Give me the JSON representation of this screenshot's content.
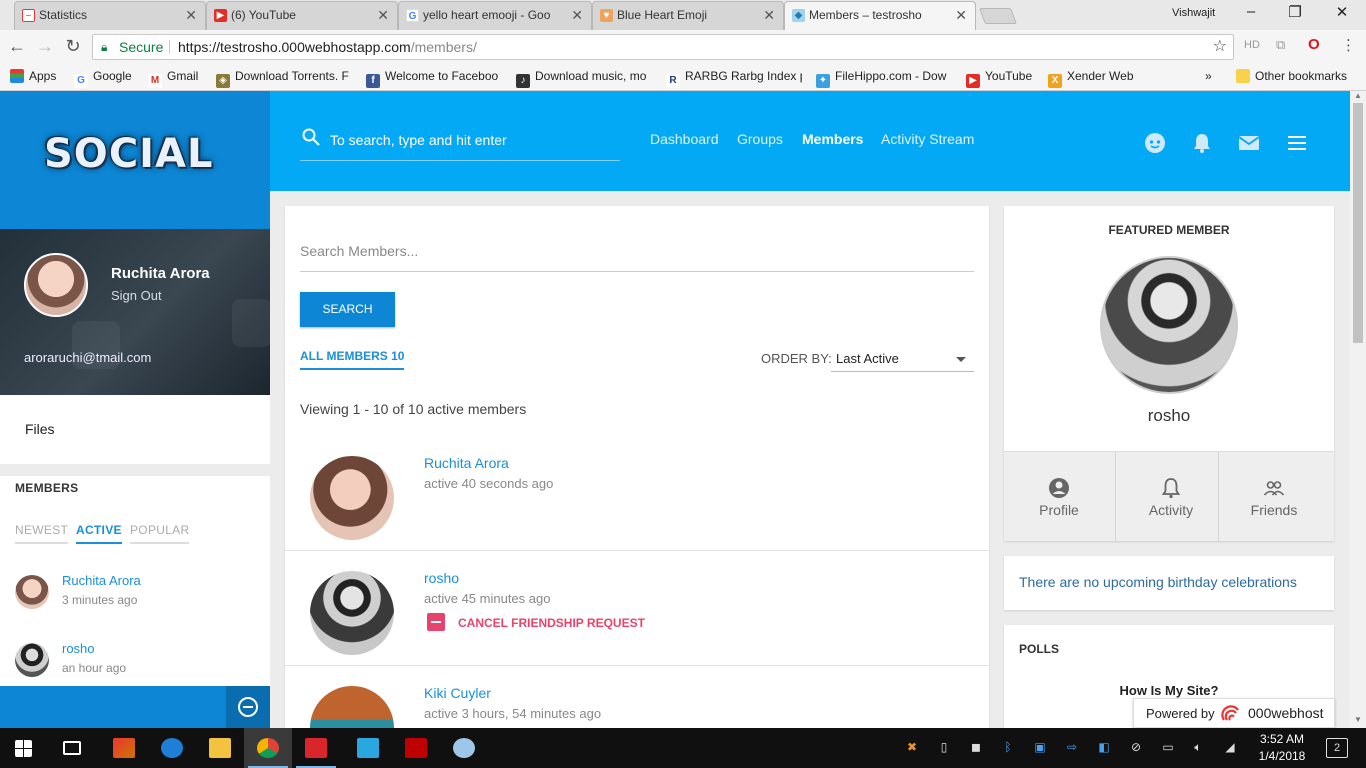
{
  "browser": {
    "tabs": [
      {
        "title": "Statistics",
        "icon": "statistics-favicon"
      },
      {
        "title": "(6) YouTube",
        "icon": "youtube-favicon"
      },
      {
        "title": "yello heart emooji - Goo",
        "icon": "google-favicon"
      },
      {
        "title": "Blue Heart Emoji",
        "icon": "blue-heart-favicon"
      },
      {
        "title": "Members – testrosho",
        "icon": "site-favicon"
      }
    ],
    "user": "Vishwajit",
    "secure_label": "Secure",
    "url_host": "https://testrosho.000webhostapp.com",
    "url_path": "/members/",
    "ext_hd": "HD",
    "bookmarks": [
      {
        "label": "Apps",
        "icon": "apps-grid-icon"
      },
      {
        "label": "Google",
        "icon": "google-icon"
      },
      {
        "label": "Gmail",
        "icon": "gmail-icon"
      },
      {
        "label": "Download Torrents. F",
        "icon": "shield-icon"
      },
      {
        "label": "Welcome to Faceboo",
        "icon": "facebook-icon"
      },
      {
        "label": "Download music, mo",
        "icon": "music-icon"
      },
      {
        "label": "RARBG Rarbg Index p",
        "icon": "rarbg-icon"
      },
      {
        "label": "FileHippo.com - Dow",
        "icon": "filehippo-icon"
      },
      {
        "label": "YouTube",
        "icon": "youtube-icon"
      },
      {
        "label": "Xender Web",
        "icon": "xender-icon"
      }
    ],
    "bookmarks_more": "»",
    "other_bookmarks": "Other bookmarks"
  },
  "site": {
    "logo": "SOCIAL",
    "search_placeholder": "To search, type and hit enter",
    "nav": [
      "Dashboard",
      "Groups",
      "Members",
      "Activity Stream"
    ],
    "nav_current": "Members"
  },
  "sidebar": {
    "profile_name": "Ruchita Arora",
    "sign_out": "Sign Out",
    "email": "aroraruchi@tmail.com",
    "files": "Files",
    "members_title": "MEMBERS",
    "tabs": [
      "NEWEST",
      "ACTIVE",
      "POPULAR"
    ],
    "active_tab": "ACTIVE",
    "members": [
      {
        "name": "Ruchita Arora",
        "time": "3 minutes ago"
      },
      {
        "name": "rosho",
        "time": "an hour ago"
      }
    ]
  },
  "main": {
    "search_placeholder": "Search Members...",
    "search_button": "SEARCH",
    "all_members": "ALL MEMBERS 10",
    "order_by_label": "ORDER BY:",
    "order_by_value": "Last Active",
    "viewing": "Viewing 1 - 10 of 10 active members",
    "members": [
      {
        "name": "Ruchita Arora",
        "time": "active 40 seconds ago"
      },
      {
        "name": "rosho",
        "time": "active 45 minutes ago",
        "action": "CANCEL FRIENDSHIP REQUEST"
      },
      {
        "name": "Kiki Cuyler",
        "time": "active 3 hours, 54 minutes ago"
      }
    ]
  },
  "right": {
    "featured_title": "FEATURED MEMBER",
    "featured_name": "rosho",
    "actions": [
      "Profile",
      "Activity",
      "Friends"
    ],
    "birthday": "There are no upcoming birthday celebrations",
    "polls_title": "POLLS",
    "poll_question": "How Is My Site?",
    "powered_by": "Powered by",
    "powered_brand": "000webhost"
  },
  "taskbar": {
    "time": "3:52 AM",
    "date": "1/4/2018",
    "notifications": "2"
  },
  "colors": {
    "accent": "#03a9f4",
    "sidebar_blue": "#0d87d5",
    "link": "#1a8fdb",
    "danger": "#e8436c"
  }
}
